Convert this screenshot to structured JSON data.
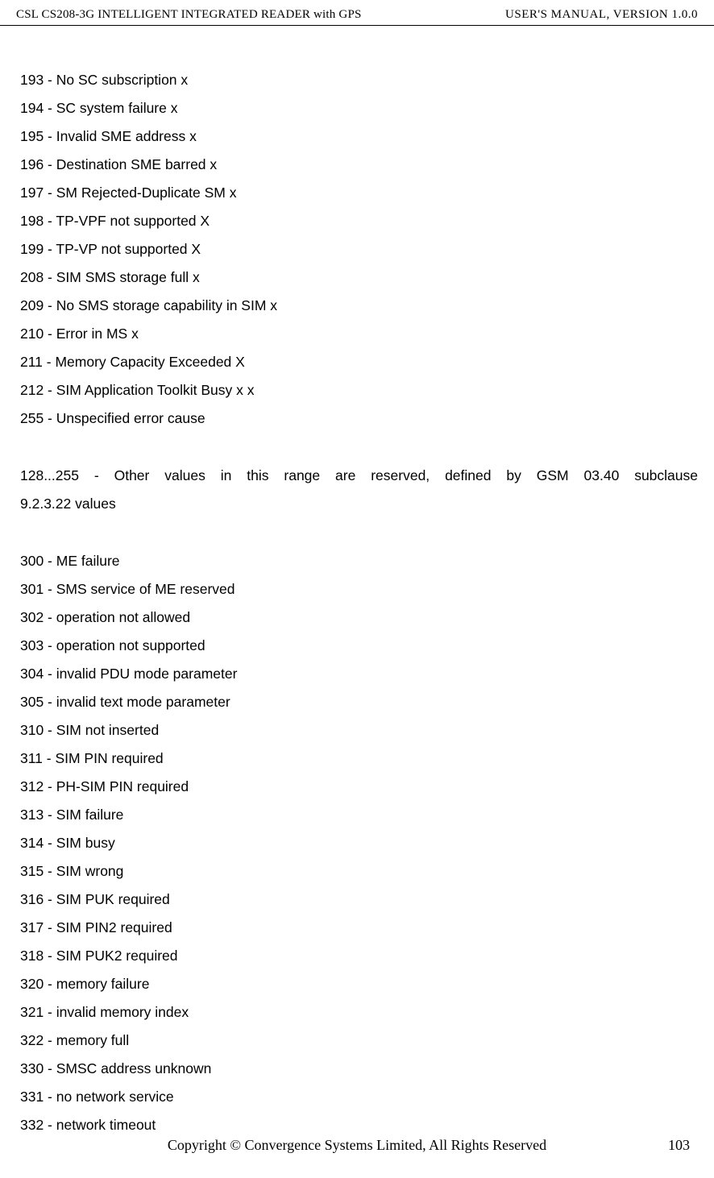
{
  "header": {
    "left": "CSL CS208-3G INTELLIGENT INTEGRATED READER with GPS",
    "right": "USER'S  MANUAL,  VERSION  1.0.0"
  },
  "errors_block1": [
    "193 - No SC subscription x",
    "194 - SC system failure x",
    "195 - Invalid SME address x",
    "196 - Destination SME barred x",
    "197 - SM Rejected-Duplicate SM x",
    "198 - TP-VPF not supported X",
    "199 - TP-VP not supported X",
    "208 - SIM SMS storage full x",
    "209 - No SMS storage capability in SIM x",
    "210 - Error in MS x",
    "211 - Memory Capacity Exceeded X",
    "212 - SIM Application Toolkit Busy x x",
    "255 - Unspecified error cause"
  ],
  "range_note": {
    "line1": "128...255  -  Other  values  in  this  range  are  reserved,  defined  by  GSM  03.40  subclause",
    "line2": "9.2.3.22 values"
  },
  "errors_block2": [
    "300 - ME failure",
    "301 - SMS service of ME reserved",
    "302 - operation not allowed",
    "303 - operation not supported",
    "304 - invalid PDU mode parameter",
    "305 - invalid text mode parameter",
    "310 - SIM not inserted",
    "311 - SIM PIN required",
    "312 - PH-SIM PIN required",
    "313 - SIM failure",
    "314 - SIM busy",
    "315 - SIM wrong",
    "316 - SIM PUK required",
    "317 - SIM PIN2 required",
    "318 - SIM PUK2 required",
    "320 - memory failure",
    "321 - invalid memory index",
    "322 - memory full",
    "330 - SMSC address unknown",
    "331 - no network service",
    "332 - network timeout"
  ],
  "footer": {
    "copyright": "Copyright © Convergence Systems Limited, All Rights Reserved",
    "page": "103"
  }
}
